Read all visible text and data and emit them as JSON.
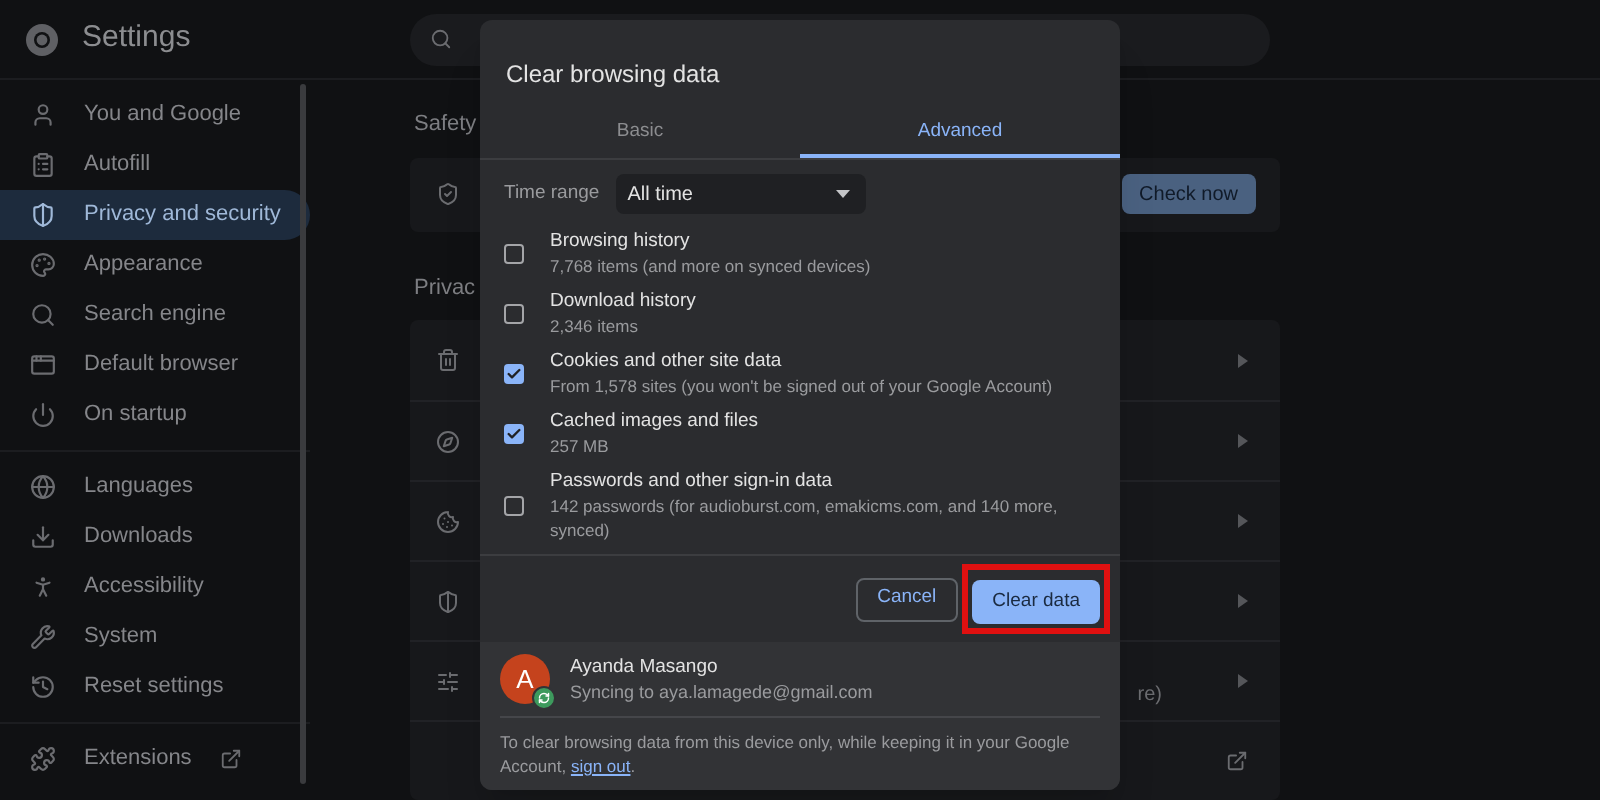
{
  "header": {
    "title": "Settings"
  },
  "sidebar": {
    "groups": [
      {
        "items": [
          {
            "label": "You and Google",
            "selected": false
          },
          {
            "label": "Autofill",
            "selected": false
          },
          {
            "label": "Privacy and security",
            "selected": true
          },
          {
            "label": "Appearance",
            "selected": false
          },
          {
            "label": "Search engine",
            "selected": false
          },
          {
            "label": "Default browser",
            "selected": false
          },
          {
            "label": "On startup",
            "selected": false
          }
        ]
      },
      {
        "items": [
          {
            "label": "Languages",
            "selected": false
          },
          {
            "label": "Downloads",
            "selected": false
          },
          {
            "label": "Accessibility",
            "selected": false
          },
          {
            "label": "System",
            "selected": false
          },
          {
            "label": "Reset settings",
            "selected": false
          }
        ]
      },
      {
        "items": [
          {
            "label": "Extensions",
            "selected": false,
            "external": true
          }
        ]
      }
    ]
  },
  "content": {
    "safety_heading": "Safety",
    "check_button": "Check now",
    "privacy_heading": "Privac",
    "rows": [
      {
        "kind": "arrow"
      },
      {
        "kind": "arrow"
      },
      {
        "kind": "arrow"
      },
      {
        "kind": "arrow"
      },
      {
        "kind": "arrow",
        "text": "re)"
      },
      {
        "kind": "external"
      }
    ]
  },
  "dialog": {
    "title": "Clear browsing data",
    "tabs": [
      {
        "label": "Basic",
        "selected": false
      },
      {
        "label": "Advanced",
        "selected": true
      }
    ],
    "time_range": {
      "label": "Time range",
      "value": "All time"
    },
    "items": [
      {
        "title": "Browsing history",
        "detail": "7,768 items (and more on synced devices)",
        "checked": false
      },
      {
        "title": "Download history",
        "detail": "2,346 items",
        "checked": false
      },
      {
        "title": "Cookies and other site data",
        "detail": "From 1,578 sites (you won't be signed out of your Google Account)",
        "checked": true
      },
      {
        "title": "Cached images and files",
        "detail": "257 MB",
        "checked": true
      },
      {
        "title": "Passwords and other sign-in data",
        "detail": "142 passwords (for audioburst.com, emakicms.com, and 140 more, synced)",
        "checked": false
      }
    ],
    "buttons": {
      "cancel": "Cancel",
      "confirm": "Clear data",
      "confirm_highlighted": true
    },
    "account": {
      "initial": "A",
      "name": "Ayanda Masango",
      "email": "Syncing to aya.lamagede@gmail.com"
    },
    "note": {
      "text": "To clear browsing data from this device only, while keeping it in your Google Account,",
      "link": "sign out",
      "end": "."
    }
  }
}
